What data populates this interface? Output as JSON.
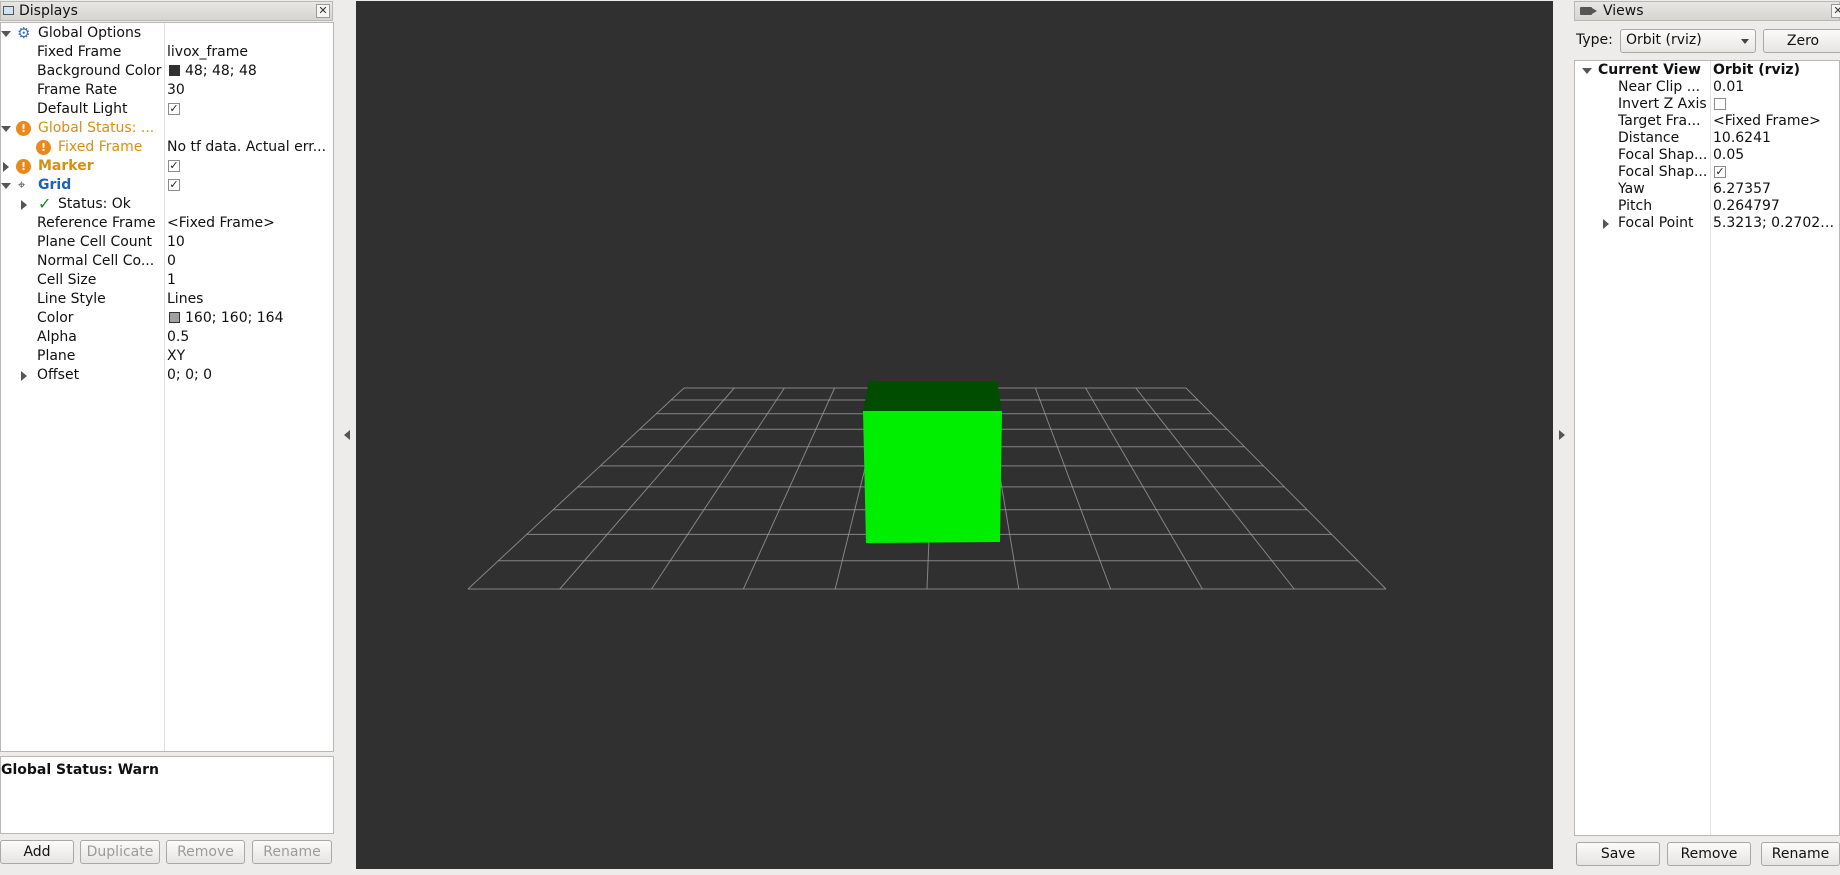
{
  "displays": {
    "title": "Displays",
    "global_options_label": "Global Options",
    "fixed_frame_label": "Fixed Frame",
    "fixed_frame_value": "livox_frame",
    "background_color_label": "Background Color",
    "background_color_value": "48; 48; 48",
    "background_color_hex": "#303030",
    "frame_rate_label": "Frame Rate",
    "frame_rate_value": "30",
    "default_light_label": "Default Light",
    "default_light_checked": true,
    "global_status_label": "Global Status: ...",
    "gs_fixed_frame_label": "Fixed Frame",
    "gs_fixed_frame_value": "No tf data.  Actual err...",
    "marker_label": "Marker",
    "marker_checked": true,
    "grid_label": "Grid",
    "grid_checked": true,
    "status_label": "Status: Ok",
    "reference_frame_label": "Reference Frame",
    "reference_frame_value": "<Fixed Frame>",
    "plane_cell_count_label": "Plane Cell Count",
    "plane_cell_count_value": "10",
    "normal_cell_count_label": "Normal Cell Co...",
    "normal_cell_count_value": "0",
    "cell_size_label": "Cell Size",
    "cell_size_value": "1",
    "line_style_label": "Line Style",
    "line_style_value": "Lines",
    "color_label": "Color",
    "color_value": "160; 160; 164",
    "color_hex": "#a0a0a4",
    "alpha_label": "Alpha",
    "alpha_value": "0.5",
    "plane_label": "Plane",
    "plane_value": "XY",
    "offset_label": "Offset",
    "offset_value": "0; 0; 0",
    "status_box_text": "Global Status: Warn",
    "buttons": {
      "add": "Add",
      "duplicate": "Duplicate",
      "remove": "Remove",
      "rename": "Rename"
    }
  },
  "views": {
    "title": "Views",
    "type_label": "Type:",
    "type_value": "Orbit (rviz)",
    "zero_button": "Zero",
    "current_view_label": "Current View",
    "current_view_value": "Orbit (rviz)",
    "near_clip_label": "Near Clip ...",
    "near_clip_value": "0.01",
    "invert_z_label": "Invert Z Axis",
    "invert_z_checked": false,
    "target_frame_label": "Target Fra...",
    "target_frame_value": "<Fixed Frame>",
    "distance_label": "Distance",
    "distance_value": "10.6241",
    "focal_shape_size_label": "Focal Shap...",
    "focal_shape_size_value": "0.05",
    "focal_shape_fixed_label": "Focal Shap...",
    "focal_shape_fixed_checked": true,
    "yaw_label": "Yaw",
    "yaw_value": "6.27357",
    "pitch_label": "Pitch",
    "pitch_value": "0.264797",
    "focal_point_label": "Focal Point",
    "focal_point_value": "5.3213; 0.27021;...",
    "buttons": {
      "save": "Save",
      "remove": "Remove",
      "rename": "Rename"
    }
  },
  "viewport": {
    "background_hex": "#303030",
    "grid_color_hex": "#a0a0a4",
    "marker_front_hex": "#00ee00",
    "marker_top_hex": "#004d00"
  },
  "colors": {
    "warn": "#d6900f",
    "grid_blue": "#1f62b5",
    "ok_green": "#1a8a1a"
  }
}
